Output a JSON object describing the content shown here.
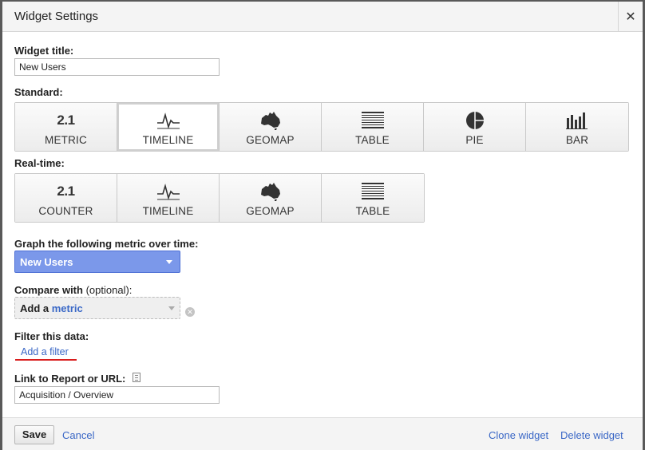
{
  "dialog": {
    "title": "Widget Settings",
    "close_label": "✕"
  },
  "widget_title": {
    "label": "Widget title:",
    "value": "New Users"
  },
  "standard": {
    "label": "Standard:",
    "buttons": [
      {
        "label": "METRIC",
        "icon": "metric-number-icon",
        "icon_text": "2.1",
        "selected": false
      },
      {
        "label": "TIMELINE",
        "icon": "timeline-icon",
        "selected": true
      },
      {
        "label": "GEOMAP",
        "icon": "geomap-icon",
        "selected": false
      },
      {
        "label": "TABLE",
        "icon": "table-icon",
        "selected": false
      },
      {
        "label": "PIE",
        "icon": "pie-icon",
        "selected": false
      },
      {
        "label": "BAR",
        "icon": "bar-icon",
        "selected": false
      }
    ]
  },
  "realtime": {
    "label": "Real-time:",
    "buttons": [
      {
        "label": "COUNTER",
        "icon": "counter-number-icon",
        "icon_text": "2.1"
      },
      {
        "label": "TIMELINE",
        "icon": "timeline-icon"
      },
      {
        "label": "GEOMAP",
        "icon": "geomap-icon"
      },
      {
        "label": "TABLE",
        "icon": "table-icon"
      }
    ]
  },
  "graph_metric": {
    "label": "Graph the following metric over time:",
    "value": "New Users"
  },
  "compare": {
    "label": "Compare with",
    "optional": "(optional):",
    "prefix": "Add a",
    "metric_word": "metric",
    "remove_label": "✕"
  },
  "filter": {
    "label": "Filter this data:",
    "link": "Add a filter"
  },
  "link": {
    "label": "Link to Report or URL:",
    "value": "Acquisition / Overview"
  },
  "footer": {
    "save": "Save",
    "cancel": "Cancel",
    "clone": "Clone widget",
    "delete": "Delete widget"
  },
  "colors": {
    "metric_select_bg": "#7b98ea",
    "link_blue": "#3a67c6",
    "underline_red": "#d91c1c"
  }
}
